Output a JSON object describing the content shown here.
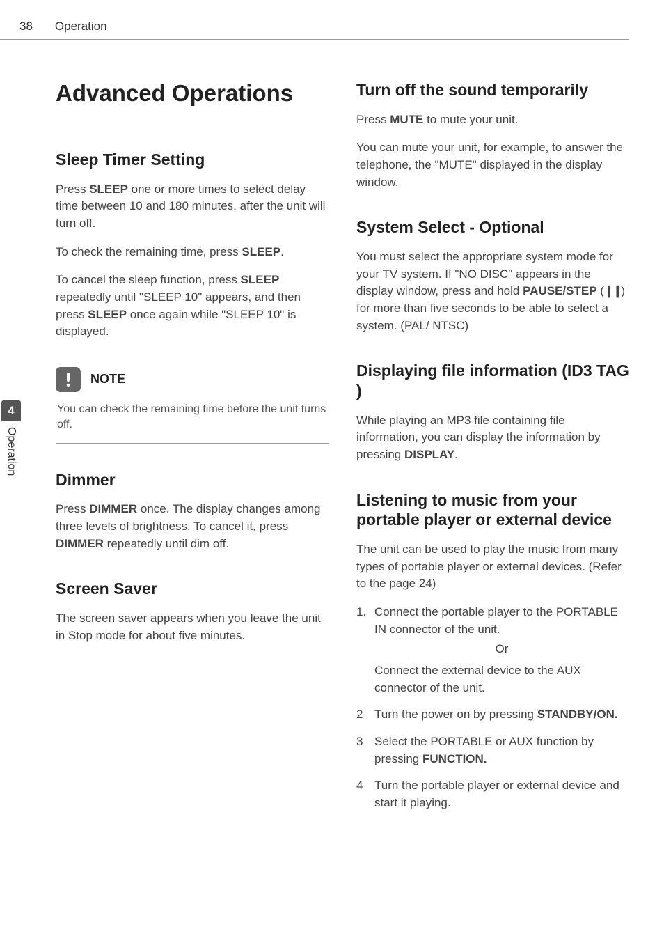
{
  "header": {
    "page_number": "38",
    "title": "Operation"
  },
  "side_tab": {
    "number": "4",
    "text": "Operation"
  },
  "left": {
    "main_title": "Advanced Operations",
    "sleep_timer": {
      "heading": "Sleep Timer Setting",
      "p1_a": "Press ",
      "p1_b": "SLEEP",
      "p1_c": " one or more times to select delay time between 10 and 180 minutes, after the unit will turn off.",
      "p2_a": "To check the remaining time, press ",
      "p2_b": "SLEEP",
      "p2_c": ".",
      "p3_a": "To cancel the sleep function, press ",
      "p3_b": "SLEEP",
      "p3_c": " repeatedly until \"SLEEP 10\" appears, and then press ",
      "p3_d": "SLEEP",
      "p3_e": " once again while \"SLEEP 10\" is displayed."
    },
    "note": {
      "label": "NOTE",
      "text": "You can check the remaining time before the unit turns off."
    },
    "dimmer": {
      "heading": "Dimmer",
      "p1_a": "Press ",
      "p1_b": "DIMMER",
      "p1_c": " once. The display changes among three levels of brightness. To cancel it, press ",
      "p1_d": "DIMMER",
      "p1_e": " repeatedly until dim off."
    },
    "screen_saver": {
      "heading": "Screen Saver",
      "p1": "The screen saver appears when you leave the unit in Stop mode for about five minutes."
    }
  },
  "right": {
    "mute": {
      "heading": "Turn off the sound temporarily",
      "p1_a": "Press ",
      "p1_b": "MUTE",
      "p1_c": " to mute your unit.",
      "p2": "You can mute your unit, for example, to answer the telephone, the \"MUTE\" displayed in the display window."
    },
    "system_select": {
      "heading": "System Select - Optional",
      "p1_a": "You must select the appropriate system mode for your TV system. If  \"NO DISC\" appears in the display window, press and hold ",
      "p1_b": "PAUSE/STEP",
      "p1_c": " (",
      "p1_d": ") for more than five seconds to be able to select a system. (PAL/ NTSC)"
    },
    "id3": {
      "heading": "Displaying file information (ID3 TAG )",
      "p1_a": "While playing an MP3 file containing file information, you can display the information by pressing ",
      "p1_b": "DISPLAY",
      "p1_c": "."
    },
    "portable": {
      "heading": "Listening to music from your portable player or external device",
      "p1": "The unit can be used to play the music from many types of portable player or external devices. (Refer to the page 24)",
      "li1_num": "1.",
      "li1": "Connect the portable player to the PORTABLE IN connector of the unit.",
      "or": "Or",
      "li1b": "Connect the external device to the AUX connector of the unit.",
      "li2_num": "2",
      "li2_a": "Turn the power on by pressing ",
      "li2_b": "STANDBY/ON.",
      "li3_num": "3",
      "li3_a": "Select the PORTABLE or AUX function by pressing ",
      "li3_b": "FUNCTION.",
      "li4_num": "4",
      "li4": "Turn the portable player or external device and start it playing."
    }
  }
}
